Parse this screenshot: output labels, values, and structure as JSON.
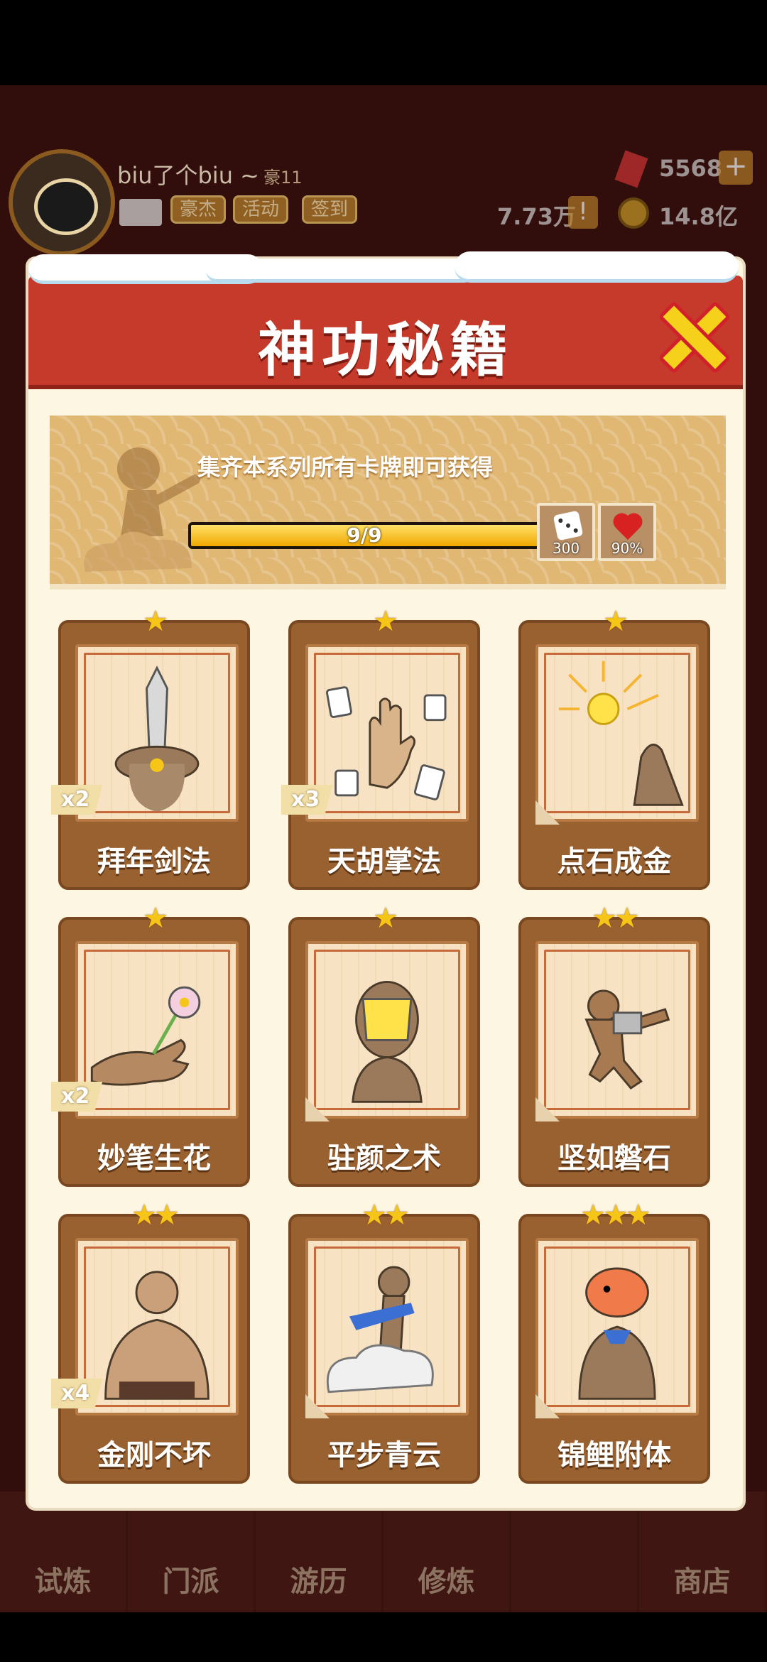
{
  "hud": {
    "player_name": "biu了个biu ~",
    "player_tag": "豪11",
    "buttons": [
      "豪杰",
      "活动",
      "签到"
    ],
    "gems": "5568",
    "power": "7.73万",
    "gold": "14.8亿"
  },
  "modal": {
    "title": "神功秘籍",
    "banner_text": "集齐本系列所有卡牌即可获得",
    "progress_text": "9/9",
    "progress_fraction": 1.0,
    "rewards": [
      {
        "icon": "dice-icon",
        "value": "300"
      },
      {
        "icon": "heart-icon",
        "value": "90%"
      }
    ]
  },
  "cards": [
    {
      "name": "拜年剑法",
      "stars": "★",
      "count": "x2"
    },
    {
      "name": "天胡掌法",
      "stars": "★",
      "count": "x3"
    },
    {
      "name": "点石成金",
      "stars": "★",
      "count": ""
    },
    {
      "name": "妙笔生花",
      "stars": "★",
      "count": "x2"
    },
    {
      "name": "驻颜之术",
      "stars": "★",
      "count": ""
    },
    {
      "name": "坚如磐石",
      "stars": "★★",
      "count": ""
    },
    {
      "name": "金刚不坏",
      "stars": "★★",
      "count": "x4"
    },
    {
      "name": "平步青云",
      "stars": "★★",
      "count": ""
    },
    {
      "name": "锦鲤附体",
      "stars": "★★★",
      "count": ""
    }
  ],
  "nav": [
    "试炼",
    "门派",
    "游历",
    "修炼",
    "",
    "商店"
  ],
  "colors": {
    "header_red": "#c63a2b",
    "card_brown": "#9a6130",
    "star_gold": "#f5c518",
    "modal_bg": "#fdf6e3"
  }
}
